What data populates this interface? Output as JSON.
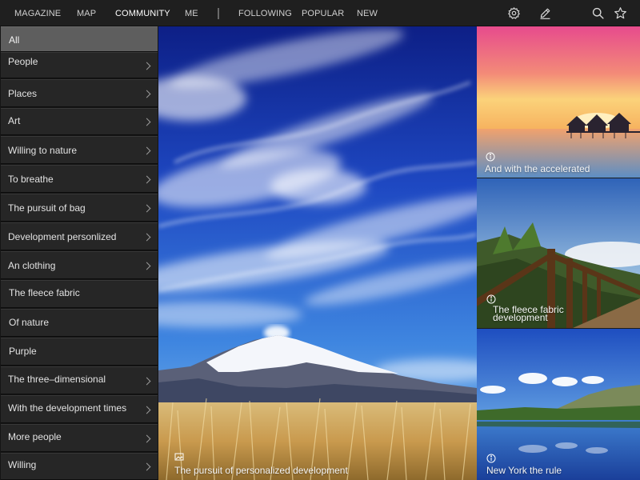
{
  "topbar": {
    "tabs": [
      {
        "label": "MAGAZINE"
      },
      {
        "label": "MAP"
      },
      {
        "label": "COMMUNITY",
        "active": true
      },
      {
        "label": "ME"
      }
    ],
    "filters": [
      {
        "label": "FOLLOWING"
      },
      {
        "label": "POPULAR"
      },
      {
        "label": "NEW"
      }
    ],
    "icons": [
      "gear-icon",
      "pencil-icon",
      "search-icon",
      "star-icon"
    ]
  },
  "sidebar": {
    "items": [
      {
        "label": "All",
        "selected": true,
        "chevron": false
      },
      {
        "label": "People",
        "chevron": true
      },
      {
        "label": "Places",
        "chevron": true
      },
      {
        "label": "Art",
        "chevron": true
      },
      {
        "label": "Willing to nature",
        "chevron": true
      },
      {
        "label": "To breathe",
        "chevron": true
      },
      {
        "label": "The pursuit of bag",
        "chevron": true
      },
      {
        "label": "Development personlized",
        "chevron": true
      },
      {
        "label": "An clothing",
        "chevron": true
      },
      {
        "label": "The fleece fabric",
        "chevron": false
      },
      {
        "label": "Of nature",
        "chevron": false
      },
      {
        "label": "Purple",
        "chevron": false
      },
      {
        "label": "The three–dimensional",
        "chevron": true
      },
      {
        "label": "With the development times",
        "chevron": true
      },
      {
        "label": "More people",
        "chevron": true
      },
      {
        "label": "Willing",
        "chevron": true
      }
    ]
  },
  "hero": {
    "caption": "The pursuit of personalized development"
  },
  "thumbnails": [
    {
      "caption": "And with the accelerated"
    },
    {
      "caption_line1": "The fleece fabric",
      "caption_line2": "development"
    },
    {
      "caption": "New York the rule"
    }
  ],
  "colors": {
    "topbar_bg": "#1f1f1f",
    "sidebar_bg": "#262626",
    "sidebar_selected": "#5e5e5e",
    "text": "#e2e2e2"
  }
}
